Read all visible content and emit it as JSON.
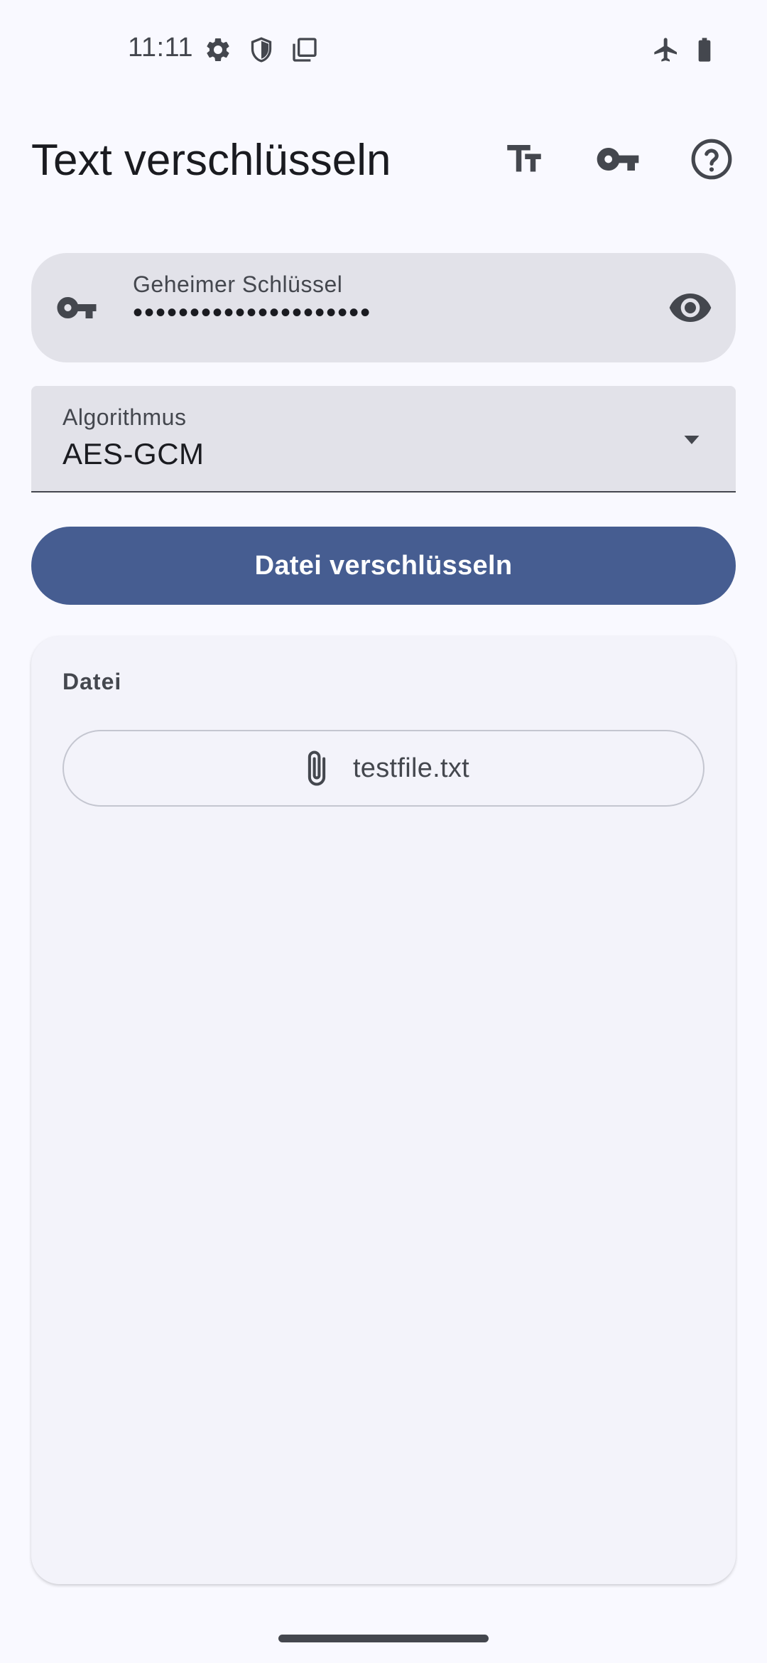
{
  "status_bar": {
    "time": "11:11",
    "left_icons": [
      "gear-icon",
      "shield-icon",
      "copy-icon"
    ],
    "right_icons": [
      "airplane-icon",
      "battery-icon"
    ]
  },
  "app_bar": {
    "title": "Text verschlüsseln",
    "actions": [
      "text-size-icon",
      "key-icon",
      "help-icon"
    ]
  },
  "key_field": {
    "label": "Geheimer Schlüssel",
    "value": "•••••••••••••••••••••",
    "leading_icon": "key-icon",
    "trailing_icon": "eye-icon"
  },
  "algorithm_field": {
    "label": "Algorithmus",
    "selected": "AES-GCM",
    "trailing_icon": "dropdown-arrow-icon"
  },
  "encrypt_button": {
    "label": "Datei verschlüsseln"
  },
  "file_card": {
    "label": "Datei",
    "file_name": "testfile.txt",
    "file_icon": "paperclip-icon"
  },
  "colors": {
    "background": "#f9f9ff",
    "field_background": "#e2e2e9",
    "primary": "#465d91",
    "on_primary": "#ffffff",
    "card_background": "#f3f3fa",
    "icon": "#44474e"
  }
}
